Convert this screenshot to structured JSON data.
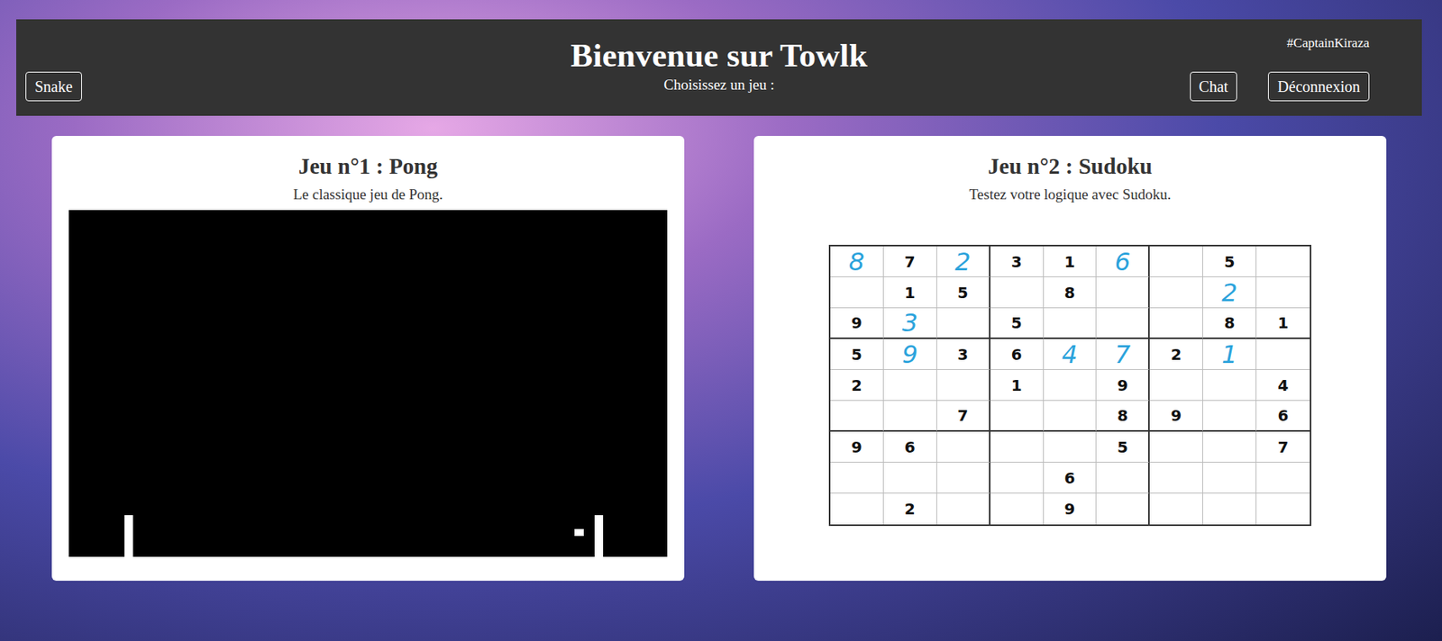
{
  "header": {
    "title": "Bienvenue sur Towlk",
    "subtitle": "Choisissez un jeu :",
    "username": "#CaptainKiraza",
    "left_buttons": [
      "Snake"
    ],
    "right_buttons": [
      "Chat",
      "Déconnexion"
    ]
  },
  "games": [
    {
      "title": "Jeu n°1 : Pong",
      "description": "Le classique jeu de Pong.",
      "kind": "pong",
      "pong": {
        "left_paddle": {
          "x": 0.1,
          "y": 0.94
        },
        "right_paddle": {
          "x": 0.886,
          "y": 0.94
        },
        "ball": {
          "x": 0.853,
          "y": 0.93
        }
      }
    },
    {
      "title": "Jeu n°2 : Sudoku",
      "description": "Testez votre logique avec Sudoku.",
      "kind": "sudoku",
      "sudoku": [
        [
          {
            "value": "8",
            "handwritten": true
          },
          {
            "value": "7",
            "handwritten": false
          },
          {
            "value": "2",
            "handwritten": true
          },
          {
            "value": "3",
            "handwritten": false
          },
          {
            "value": "1",
            "handwritten": false
          },
          {
            "value": "6",
            "handwritten": true
          },
          {
            "value": "",
            "handwritten": false
          },
          {
            "value": "5",
            "handwritten": false
          },
          {
            "value": "",
            "handwritten": false
          }
        ],
        [
          {
            "value": "",
            "handwritten": false
          },
          {
            "value": "1",
            "handwritten": false
          },
          {
            "value": "5",
            "handwritten": false
          },
          {
            "value": "",
            "handwritten": false
          },
          {
            "value": "8",
            "handwritten": false
          },
          {
            "value": "",
            "handwritten": false
          },
          {
            "value": "",
            "handwritten": false
          },
          {
            "value": "2",
            "handwritten": true
          },
          {
            "value": "",
            "handwritten": false
          }
        ],
        [
          {
            "value": "9",
            "handwritten": false
          },
          {
            "value": "3",
            "handwritten": true
          },
          {
            "value": "",
            "handwritten": false
          },
          {
            "value": "5",
            "handwritten": false
          },
          {
            "value": "",
            "handwritten": false
          },
          {
            "value": "",
            "handwritten": false
          },
          {
            "value": "",
            "handwritten": false
          },
          {
            "value": "8",
            "handwritten": false
          },
          {
            "value": "1",
            "handwritten": false
          }
        ],
        [
          {
            "value": "5",
            "handwritten": false
          },
          {
            "value": "9",
            "handwritten": true
          },
          {
            "value": "3",
            "handwritten": false
          },
          {
            "value": "6",
            "handwritten": false
          },
          {
            "value": "4",
            "handwritten": true
          },
          {
            "value": "7",
            "handwritten": true
          },
          {
            "value": "2",
            "handwritten": false
          },
          {
            "value": "1",
            "handwritten": true
          },
          {
            "value": "",
            "handwritten": false
          }
        ],
        [
          {
            "value": "2",
            "handwritten": false
          },
          {
            "value": "",
            "handwritten": false
          },
          {
            "value": "",
            "handwritten": false
          },
          {
            "value": "1",
            "handwritten": false
          },
          {
            "value": "",
            "handwritten": false
          },
          {
            "value": "9",
            "handwritten": false
          },
          {
            "value": "",
            "handwritten": false
          },
          {
            "value": "",
            "handwritten": false
          },
          {
            "value": "4",
            "handwritten": false
          }
        ],
        [
          {
            "value": "",
            "handwritten": false
          },
          {
            "value": "",
            "handwritten": false
          },
          {
            "value": "7",
            "handwritten": false
          },
          {
            "value": "",
            "handwritten": false
          },
          {
            "value": "",
            "handwritten": false
          },
          {
            "value": "8",
            "handwritten": false
          },
          {
            "value": "9",
            "handwritten": false
          },
          {
            "value": "",
            "handwritten": false
          },
          {
            "value": "6",
            "handwritten": false
          }
        ],
        [
          {
            "value": "9",
            "handwritten": false
          },
          {
            "value": "6",
            "handwritten": false
          },
          {
            "value": "",
            "handwritten": false
          },
          {
            "value": "",
            "handwritten": false
          },
          {
            "value": "",
            "handwritten": false
          },
          {
            "value": "5",
            "handwritten": false
          },
          {
            "value": "",
            "handwritten": false
          },
          {
            "value": "",
            "handwritten": false
          },
          {
            "value": "7",
            "handwritten": false
          }
        ],
        [
          {
            "value": "",
            "handwritten": false
          },
          {
            "value": "",
            "handwritten": false
          },
          {
            "value": "",
            "handwritten": false
          },
          {
            "value": "",
            "handwritten": false
          },
          {
            "value": "6",
            "handwritten": false
          },
          {
            "value": "",
            "handwritten": false
          },
          {
            "value": "",
            "handwritten": false
          },
          {
            "value": "",
            "handwritten": false
          },
          {
            "value": "",
            "handwritten": false
          }
        ],
        [
          {
            "value": "",
            "handwritten": false
          },
          {
            "value": "2",
            "handwritten": false
          },
          {
            "value": "",
            "handwritten": false
          },
          {
            "value": "",
            "handwritten": false
          },
          {
            "value": "9",
            "handwritten": false
          },
          {
            "value": "",
            "handwritten": false
          },
          {
            "value": "",
            "handwritten": false
          },
          {
            "value": "",
            "handwritten": false
          },
          {
            "value": "",
            "handwritten": false
          }
        ]
      ]
    }
  ]
}
